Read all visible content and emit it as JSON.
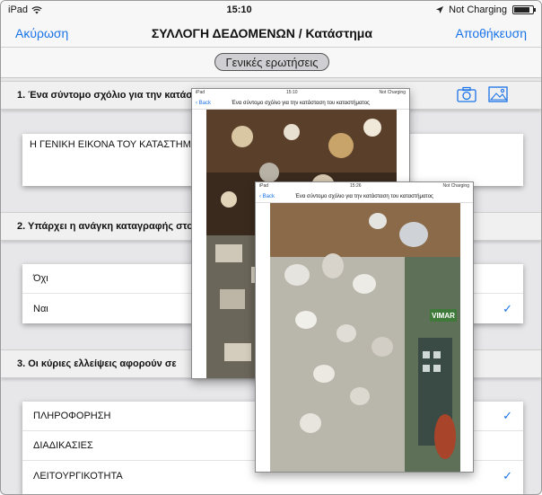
{
  "status": {
    "device": "iPad",
    "time": "15:10",
    "battery_text": "Not Charging",
    "battery_level": 0.85
  },
  "nav": {
    "cancel": "Ακύρωση",
    "title": "ΣΥΛΛΟΓΗ ΔΕΔΟΜΕΝΩΝ / Κατάστημα",
    "save": "Αποθήκευση"
  },
  "segment": {
    "label": "Γενικές ερωτήσεις"
  },
  "questions": {
    "q1": {
      "title": "1. Ένα σύντομο σχόλιο για την κατάστ",
      "answer": "Η ΓΕΝΙΚΗ ΕΙΚΟΝΑ ΤΟΥ ΚΑΤΑΣΤΗΜΑ"
    },
    "q2": {
      "title": "2. Υπάρχει η ανάγκη καταγραφής στο",
      "options": [
        "Όχι",
        "Ναι"
      ],
      "checked": [
        false,
        true
      ]
    },
    "q3": {
      "title": "3. Οι κύριες ελλείψεις αφορούν σε",
      "options": [
        "ΠΛΗΡΟΦΟΡΗΣΗ",
        "ΔΙΑΔΙΚΑΣΙΕΣ",
        "ΛΕΙΤΟΥΡΓΙΚΟΤΗΤΑ"
      ],
      "checked": [
        true,
        false,
        true
      ]
    }
  },
  "icons": {
    "camera": "camera-icon",
    "gallery": "photo-gallery-icon",
    "check": "checkmark-icon"
  },
  "shot1": {
    "device": "iPad",
    "time": "15:10",
    "battery": "Not Charging",
    "back": "Back",
    "title": "Ένα σύντομο σχόλιο για την κατάσταση του καταστήματος"
  },
  "shot2": {
    "device": "iPad",
    "time": "15:26",
    "battery": "Not Charging",
    "back": "Back",
    "title": "Ένα σύντομο σχόλιο για την κατάσταση του καταστήματος",
    "sign": "VIMAR"
  },
  "colors": {
    "accent": "#1a73e8"
  }
}
